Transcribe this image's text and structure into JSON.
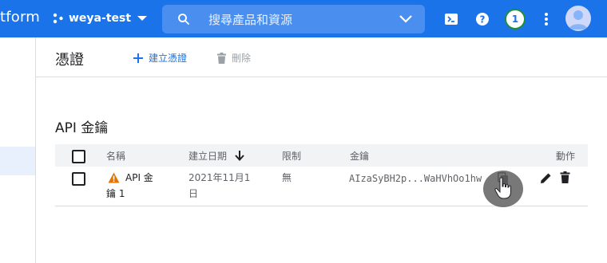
{
  "topbar": {
    "brand": "tform",
    "project_name": "weya-test",
    "search_placeholder": "搜尋產品和資源",
    "notifications_count": "1"
  },
  "actionbar": {
    "title": "憑證",
    "create_label": "建立憑證",
    "delete_label": "刪除"
  },
  "section": {
    "title": "API 金鑰"
  },
  "table": {
    "headers": {
      "name": "名稱",
      "created": "建立日期",
      "restriction": "限制",
      "key": "金鑰",
      "actions": "動作"
    },
    "rows": [
      {
        "name_line1": "API 金",
        "name_line2": "鑰 1",
        "created_line1": "2021年11月1",
        "created_line2": "日",
        "restriction": "無",
        "key": "AIzaSyBH2p...WaHVhOo1hw"
      }
    ]
  },
  "colors": {
    "accent": "#1a73e8",
    "warning": "#e37400",
    "badge_ring": "#1e8e3e"
  },
  "icons": [
    "project-dots-icon",
    "search-icon",
    "chevron-down-icon",
    "cloud-shell-icon",
    "help-icon",
    "more-vert-icon",
    "avatar-icon",
    "add-icon",
    "trash-icon",
    "arrow-down-icon",
    "warning-icon",
    "copy-icon",
    "edit-icon",
    "delete-icon"
  ]
}
